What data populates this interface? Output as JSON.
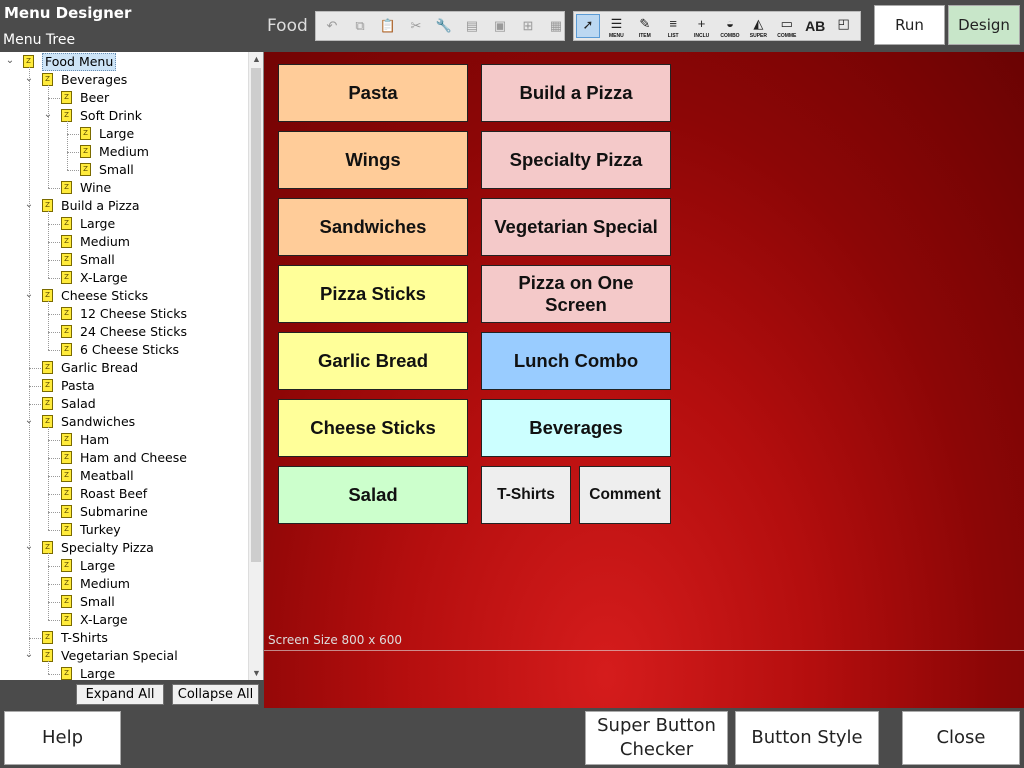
{
  "app": {
    "title": "Menu Designer",
    "tree_title": "Menu Tree",
    "menu_name": "Food"
  },
  "tree": {
    "items": [
      {
        "label": "Food Menu",
        "depth": 0,
        "toggle": "open",
        "selected": true
      },
      {
        "label": "Beverages",
        "depth": 1,
        "toggle": "open"
      },
      {
        "label": "Beer",
        "depth": 2,
        "toggle": ""
      },
      {
        "label": "Soft Drink",
        "depth": 2,
        "toggle": "open"
      },
      {
        "label": "Large",
        "depth": 3,
        "toggle": ""
      },
      {
        "label": "Medium",
        "depth": 3,
        "toggle": ""
      },
      {
        "label": "Small",
        "depth": 3,
        "toggle": ""
      },
      {
        "label": "Wine",
        "depth": 2,
        "toggle": ""
      },
      {
        "label": "Build a Pizza",
        "depth": 1,
        "toggle": "open"
      },
      {
        "label": "Large",
        "depth": 2,
        "toggle": ""
      },
      {
        "label": "Medium",
        "depth": 2,
        "toggle": ""
      },
      {
        "label": "Small",
        "depth": 2,
        "toggle": ""
      },
      {
        "label": "X-Large",
        "depth": 2,
        "toggle": ""
      },
      {
        "label": "Cheese Sticks",
        "depth": 1,
        "toggle": "open"
      },
      {
        "label": "12 Cheese Sticks",
        "depth": 2,
        "toggle": ""
      },
      {
        "label": "24 Cheese Sticks",
        "depth": 2,
        "toggle": ""
      },
      {
        "label": "6 Cheese Sticks",
        "depth": 2,
        "toggle": ""
      },
      {
        "label": "Garlic Bread",
        "depth": 1,
        "toggle": ""
      },
      {
        "label": "Pasta",
        "depth": 1,
        "toggle": ""
      },
      {
        "label": "Salad",
        "depth": 1,
        "toggle": ""
      },
      {
        "label": "Sandwiches",
        "depth": 1,
        "toggle": "open"
      },
      {
        "label": "Ham",
        "depth": 2,
        "toggle": ""
      },
      {
        "label": "Ham and Cheese",
        "depth": 2,
        "toggle": ""
      },
      {
        "label": "Meatball",
        "depth": 2,
        "toggle": ""
      },
      {
        "label": "Roast Beef",
        "depth": 2,
        "toggle": ""
      },
      {
        "label": "Submarine",
        "depth": 2,
        "toggle": ""
      },
      {
        "label": "Turkey",
        "depth": 2,
        "toggle": ""
      },
      {
        "label": "Specialty Pizza",
        "depth": 1,
        "toggle": "open"
      },
      {
        "label": "Large",
        "depth": 2,
        "toggle": ""
      },
      {
        "label": "Medium",
        "depth": 2,
        "toggle": ""
      },
      {
        "label": "Small",
        "depth": 2,
        "toggle": ""
      },
      {
        "label": "X-Large",
        "depth": 2,
        "toggle": ""
      },
      {
        "label": "T-Shirts",
        "depth": 1,
        "toggle": ""
      },
      {
        "label": "Vegetarian Special",
        "depth": 1,
        "toggle": "open"
      },
      {
        "label": "Large",
        "depth": 2,
        "toggle": ""
      }
    ],
    "expand_all_label": "Expand All",
    "collapse_all_label": "Collapse All"
  },
  "toolbar": {
    "edit_tools": [
      {
        "name": "undo-icon",
        "glyph": "↶"
      },
      {
        "name": "copy-icon",
        "glyph": "⧉"
      },
      {
        "name": "paste-icon",
        "glyph": "📋"
      },
      {
        "name": "cut-icon",
        "glyph": "✂"
      },
      {
        "name": "wrench-icon",
        "glyph": "🔧"
      },
      {
        "name": "align-icon",
        "glyph": "▤"
      },
      {
        "name": "resize-icon",
        "glyph": "▣"
      },
      {
        "name": "grid-icon",
        "glyph": "⊞"
      },
      {
        "name": "calculator-icon",
        "glyph": "▦"
      }
    ],
    "object_tools": [
      {
        "name": "pointer-icon",
        "glyph": "➚",
        "caption": "",
        "active": true
      },
      {
        "name": "menu-tool-icon",
        "glyph": "☰",
        "caption": "MENU"
      },
      {
        "name": "item-tool-icon",
        "glyph": "✎",
        "caption": "ITEM"
      },
      {
        "name": "list-tool-icon",
        "glyph": "≡",
        "caption": "LIST"
      },
      {
        "name": "include-tool-icon",
        "glyph": "+",
        "caption": "INCLU"
      },
      {
        "name": "combo-tool-icon",
        "glyph": "◒",
        "caption": "COMBO"
      },
      {
        "name": "super-tool-icon",
        "glyph": "◭",
        "caption": "SUPER"
      },
      {
        "name": "comment-tool-icon",
        "glyph": "▭",
        "caption": "COMME"
      },
      {
        "name": "text-tool-icon",
        "glyph": "AB",
        "caption": ""
      },
      {
        "name": "shape-tool-icon",
        "glyph": "◰",
        "caption": ""
      }
    ],
    "run_label": "Run",
    "design_label": "Design"
  },
  "canvas": {
    "screen_size_label": "Screen Size 800 x 600",
    "buttons": [
      {
        "label": "Pasta",
        "color": "#ffcc99"
      },
      {
        "label": "Build a Pizza",
        "color": "#f4c9c9"
      },
      {
        "label": "Wings",
        "color": "#ffcc99"
      },
      {
        "label": "Specialty Pizza",
        "color": "#f4c9c9"
      },
      {
        "label": "Sandwiches",
        "color": "#ffcc99"
      },
      {
        "label": "Vegetarian Special",
        "color": "#f4c9c9"
      },
      {
        "label": "Pizza Sticks",
        "color": "#ffff99"
      },
      {
        "label": "Pizza on One Screen",
        "color": "#f4c9c9"
      },
      {
        "label": "Garlic Bread",
        "color": "#ffff99"
      },
      {
        "label": "Lunch Combo",
        "color": "#99ccff"
      },
      {
        "label": "Cheese Sticks",
        "color": "#ffff99"
      },
      {
        "label": "Beverages",
        "color": "#ccffff"
      },
      {
        "label": "Salad",
        "color": "#ccffcc"
      },
      {
        "label": "T-Shirts",
        "color": "#eeeeee"
      },
      {
        "label": "Comment",
        "color": "#eeeeee"
      }
    ]
  },
  "bottom": {
    "help_label": "Help",
    "super_button_checker_label": "Super Button Checker",
    "button_style_label": "Button Style",
    "close_label": "Close"
  }
}
